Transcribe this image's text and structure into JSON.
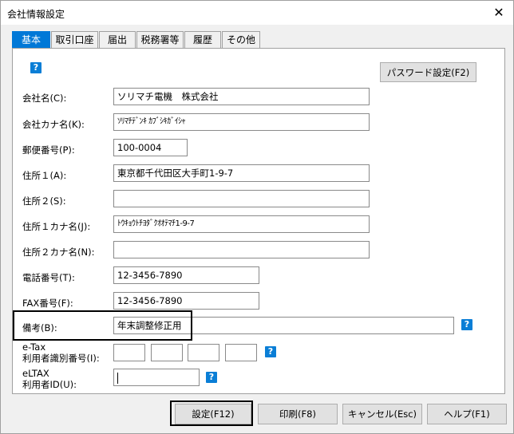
{
  "window": {
    "title": "会社情報設定",
    "close": "✕"
  },
  "tabs": [
    {
      "label": "基本",
      "active": true
    },
    {
      "label": "取引口座"
    },
    {
      "label": "届出"
    },
    {
      "label": "税務署等"
    },
    {
      "label": "履歴"
    },
    {
      "label": "その他"
    }
  ],
  "help_icon": "?",
  "password_button": "パスワード設定(F2)",
  "fields": {
    "company_name": {
      "label": "会社名(C):",
      "value": "ソリマチ電機　株式会社"
    },
    "company_kana": {
      "label": "会社カナ名(K):",
      "value": "ｿﾘﾏﾁﾃﾞﾝｷ ｶﾌﾞｼｷｶﾞｲｼｬ"
    },
    "postal_code": {
      "label": "郵便番号(P):",
      "value": "100-0004"
    },
    "address1": {
      "label": "住所１(A):",
      "value": "東京都千代田区大手町1-9-7"
    },
    "address2": {
      "label": "住所２(S):",
      "value": ""
    },
    "address1_kana": {
      "label": "住所１カナ名(J):",
      "value": "ﾄｳｷｮｳﾄﾁﾖﾀﾞｸｵｵﾃﾏﾁ1-9-7"
    },
    "address2_kana": {
      "label": "住所２カナ名(N):",
      "value": ""
    },
    "phone": {
      "label": "電話番号(T):",
      "value": "12-3456-7890"
    },
    "fax": {
      "label": "FAX番号(F):",
      "value": "12-3456-7890"
    },
    "notes": {
      "label": "備考(B):",
      "value": "年末調整修正用"
    },
    "etax": {
      "label_line1": "e-Tax",
      "label_line2": "利用者識別番号(I):",
      "values": [
        "",
        "",
        "",
        ""
      ]
    },
    "eltax": {
      "label_line1": "eLTAX",
      "label_line2": "利用者ID(U):",
      "value": ""
    }
  },
  "footer": {
    "set": "設定(F12)",
    "print": "印刷(F8)",
    "cancel": "キャンセル(Esc)",
    "help": "ヘルプ(F1)"
  }
}
